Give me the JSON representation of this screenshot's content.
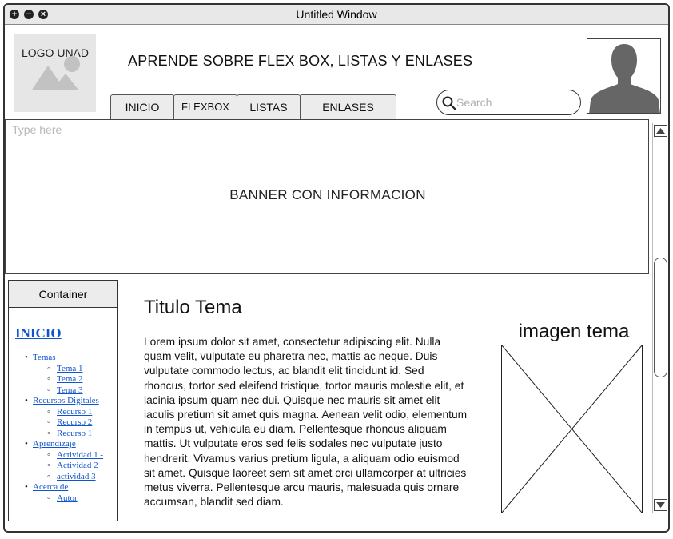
{
  "window": {
    "title": "Untitled Window"
  },
  "header": {
    "logo_text": "LOGO UNAD",
    "heading": "APRENDE SOBRE FLEX BOX, LISTAS Y ENLASES"
  },
  "tabs": [
    {
      "label": "INICIO"
    },
    {
      "label": "FLEXBOX"
    },
    {
      "label": "LISTAS"
    },
    {
      "label": "ENLASES"
    }
  ],
  "search": {
    "placeholder": "Search"
  },
  "banner": {
    "placeholder": "Type here",
    "text": "BANNER CON INFORMACION"
  },
  "sidebar": {
    "header": "Container",
    "title": "INICIO",
    "groups": [
      {
        "label": "Temas",
        "items": [
          "Tema 1",
          "Tema 2",
          "Tema 3"
        ]
      },
      {
        "label": "Recursos Digitales",
        "items": [
          "Recurso 1",
          "Recurso 2",
          "Recurso 1"
        ]
      },
      {
        "label": "Aprendizaje",
        "items": [
          "Actividad 1 -",
          "Actividad 2",
          "actividad 3"
        ]
      },
      {
        "label": "Acerca de",
        "items": [
          "Autor"
        ]
      }
    ]
  },
  "main": {
    "title": "Titulo Tema",
    "body": "Lorem ipsum dolor sit amet, consectetur adipiscing elit. Nulla quam velit, vulputate eu pharetra nec, mattis ac neque. Duis vulputate commodo lectus, ac blandit elit tincidunt id. Sed rhoncus, tortor sed eleifend tristique, tortor mauris molestie elit, et lacinia ipsum quam nec dui. Quisque nec mauris sit amet elit iaculis pretium sit amet quis magna. Aenean velit odio, elementum in tempus ut, vehicula eu diam. Pellentesque rhoncus aliquam mattis. Ut vulputate eros sed felis sodales nec vulputate justo hendrerit. Vivamus varius pretium ligula, a aliquam odio euismod sit amet. Quisque laoreet sem sit amet orci ullamcorper at ultricies metus viverra. Pellentesque arcu mauris, malesuada quis ornare accumsan, blandit sed diam.",
    "image_title": "imagen tema"
  },
  "icons": {
    "window_close": "close-icon",
    "window_minimize": "minimize-icon",
    "window_maximize": "maximize-icon",
    "search": "search-icon",
    "avatar": "user-silhouette-icon",
    "logo": "image-placeholder-icon",
    "scroll_up": "arrow-up-icon",
    "scroll_down": "arrow-down-icon"
  }
}
